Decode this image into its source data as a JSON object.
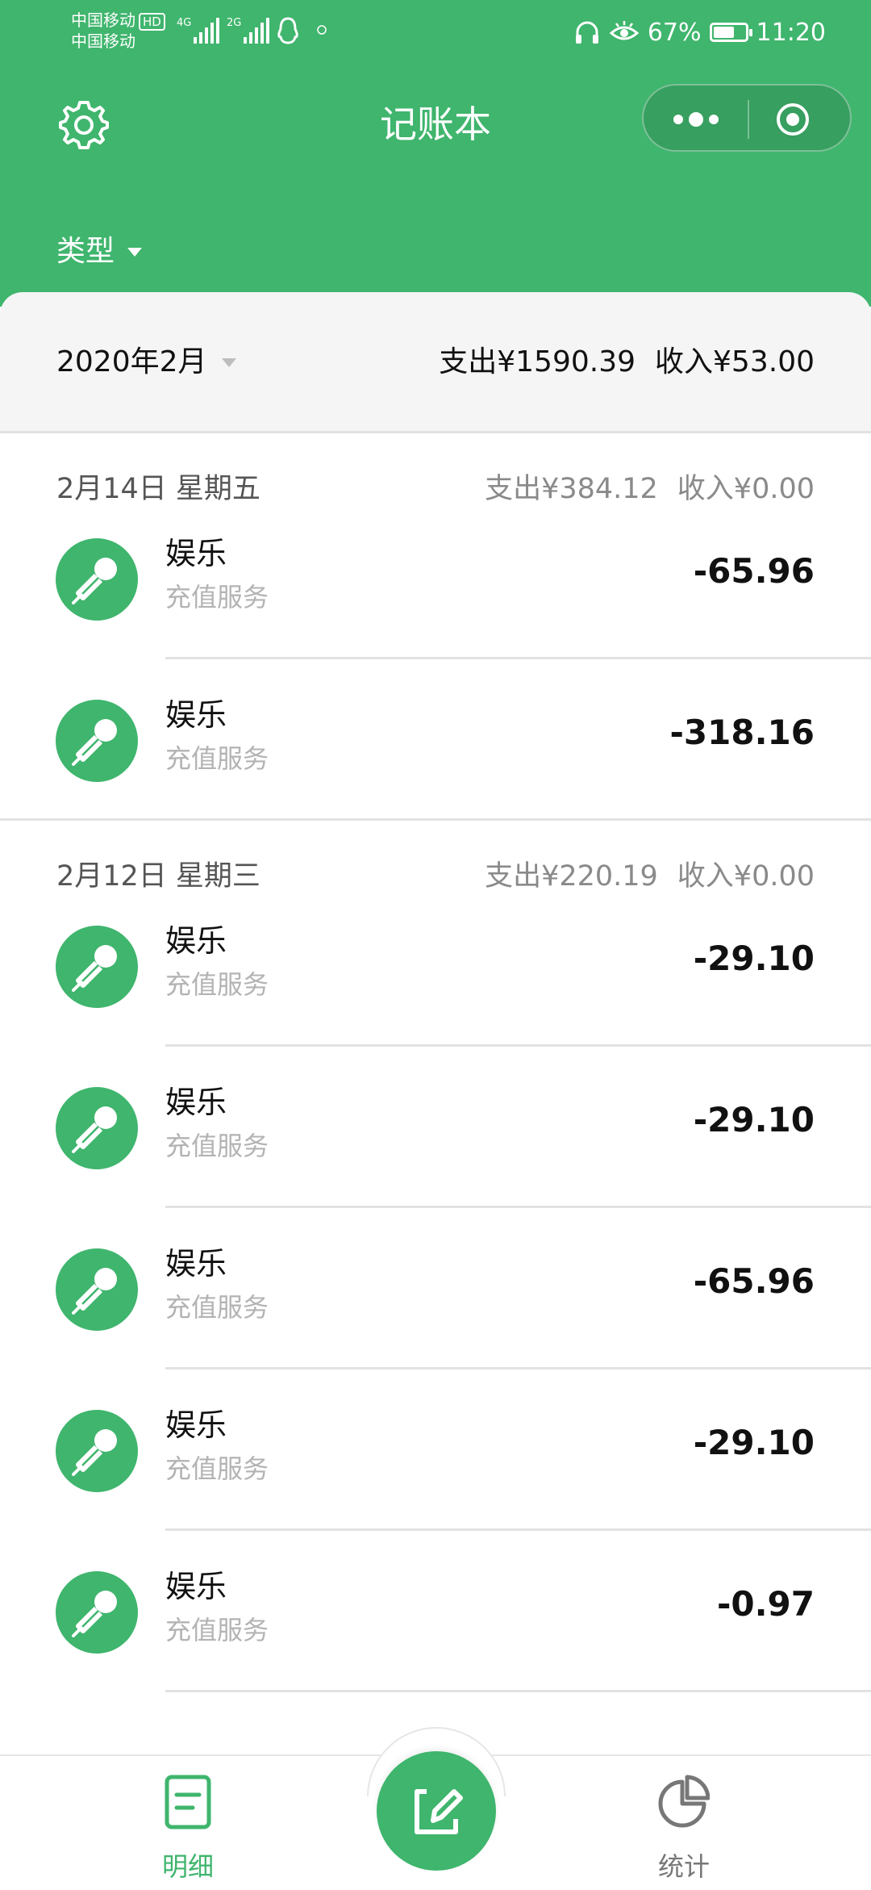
{
  "status_bar": {
    "carrier_1": "中国移动",
    "carrier_1_badge": "HD",
    "carrier_2": "中国移动",
    "net_1": "4G",
    "net_2": "2G",
    "battery_percent": "67%",
    "battery_level": 0.67,
    "time": "11:20"
  },
  "header": {
    "title": "记账本",
    "filter_label": "类型"
  },
  "month_bar": {
    "month": "2020年2月",
    "expense": "支出¥1590.39",
    "income": "收入¥53.00"
  },
  "groups": [
    {
      "date": "2月14日 星期五",
      "expense": "支出¥384.12",
      "income": "收入¥0.00",
      "entries": [
        {
          "category": "娱乐",
          "note": "充值服务",
          "amount": "-65.96"
        },
        {
          "category": "娱乐",
          "note": "充值服务",
          "amount": "-318.16"
        }
      ]
    },
    {
      "date": "2月12日 星期三",
      "expense": "支出¥220.19",
      "income": "收入¥0.00",
      "entries": [
        {
          "category": "娱乐",
          "note": "充值服务",
          "amount": "-29.10"
        },
        {
          "category": "娱乐",
          "note": "充值服务",
          "amount": "-29.10"
        },
        {
          "category": "娱乐",
          "note": "充值服务",
          "amount": "-65.96"
        },
        {
          "category": "娱乐",
          "note": "充值服务",
          "amount": "-29.10"
        },
        {
          "category": "娱乐",
          "note": "充值服务",
          "amount": "-0.97"
        }
      ]
    }
  ],
  "tabbar": {
    "detail_label": "明细",
    "stats_label": "统计"
  },
  "icons": {
    "entry_icon": "microphone-icon",
    "settings": "gear-icon",
    "more": "more-dots-icon",
    "close_mini": "target-icon",
    "add": "edit-icon",
    "detail_tab": "document-icon",
    "stats_tab": "pie-chart-icon"
  },
  "colors": {
    "brand_green": "#3fb56d",
    "muted_text": "#8a8a8a",
    "placeholder_text": "#b3b3b3"
  }
}
